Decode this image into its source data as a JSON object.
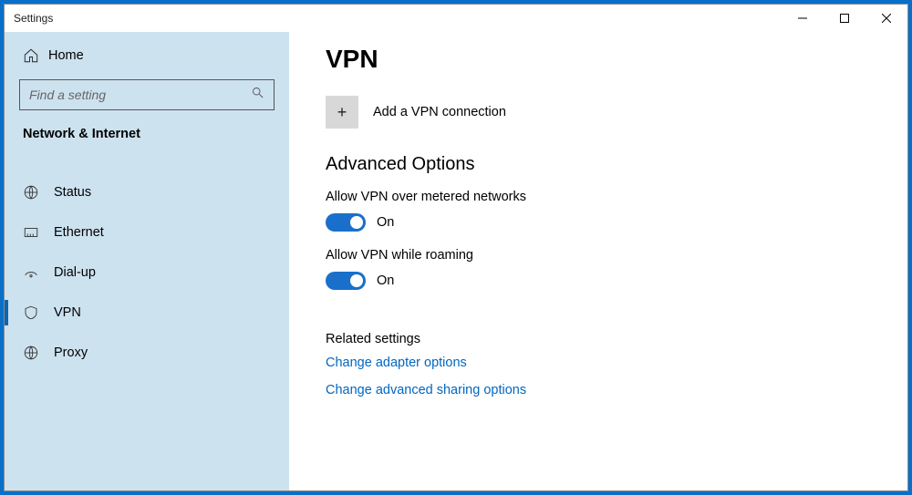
{
  "titlebar": {
    "label": "Settings"
  },
  "sidebar": {
    "home_label": "Home",
    "search_placeholder": "Find a setting",
    "group_label": "Network & Internet",
    "items": [
      {
        "label": "Status"
      },
      {
        "label": "Ethernet"
      },
      {
        "label": "Dial-up"
      },
      {
        "label": "VPN"
      },
      {
        "label": "Proxy"
      }
    ]
  },
  "content": {
    "title": "VPN",
    "add_label": "Add a VPN connection",
    "advanced_head": "Advanced Options",
    "settings": [
      {
        "label": "Allow VPN over metered networks",
        "state": "On"
      },
      {
        "label": "Allow VPN while roaming",
        "state": "On"
      }
    ],
    "related_head": "Related settings",
    "links": [
      "Change adapter options",
      "Change advanced sharing options"
    ]
  }
}
